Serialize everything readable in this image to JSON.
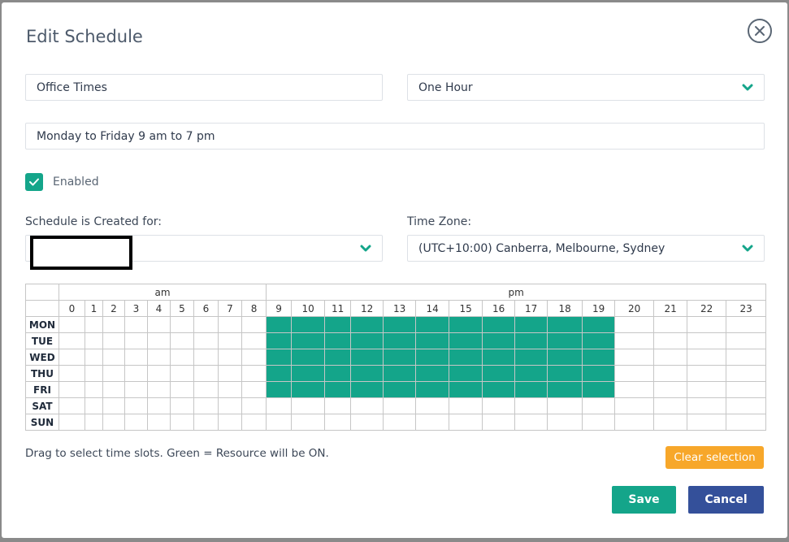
{
  "modal": {
    "title": "Edit Schedule",
    "close_icon": "close-circle-icon"
  },
  "form": {
    "name": {
      "value": "Office Times"
    },
    "interval": {
      "value": "One Hour",
      "icon": "chevron-down-icon"
    },
    "description": {
      "value": "Monday to Friday 9 am to 7 pm"
    },
    "enabled": {
      "label": "Enabled",
      "checked": true
    },
    "created_for": {
      "label": "Schedule is Created for:",
      "value": "",
      "icon": "chevron-down-icon"
    },
    "timezone": {
      "label": "Time Zone:",
      "value": "(UTC+10:00) Canberra, Melbourne, Sydney",
      "icon": "chevron-down-icon"
    }
  },
  "grid": {
    "am_label": "am",
    "pm_label": "pm",
    "hours": [
      "0",
      "1",
      "2",
      "3",
      "4",
      "5",
      "6",
      "7",
      "8",
      "9",
      "10",
      "11",
      "12",
      "13",
      "14",
      "15",
      "16",
      "17",
      "18",
      "19",
      "20",
      "21",
      "22",
      "23"
    ],
    "days": [
      "MON",
      "TUE",
      "WED",
      "THU",
      "FRI",
      "SAT",
      "SUN"
    ],
    "selected_color": "#14a58a",
    "selected": {
      "MON": [
        9,
        10,
        11,
        12,
        13,
        14,
        15,
        16,
        17,
        18,
        19
      ],
      "TUE": [
        9,
        10,
        11,
        12,
        13,
        14,
        15,
        16,
        17,
        18,
        19
      ],
      "WED": [
        9,
        10,
        11,
        12,
        13,
        14,
        15,
        16,
        17,
        18,
        19
      ],
      "THU": [
        9,
        10,
        11,
        12,
        13,
        14,
        15,
        16,
        17,
        18,
        19
      ],
      "FRI": [
        9,
        10,
        11,
        12,
        13,
        14,
        15,
        16,
        17,
        18,
        19
      ],
      "SAT": [],
      "SUN": []
    }
  },
  "hint": "Drag to select time slots. Green = Resource will be ON.",
  "buttons": {
    "clear": "Clear selection",
    "save": "Save",
    "cancel": "Cancel"
  },
  "colors": {
    "accent": "#14a58a",
    "warning": "#f7a72a",
    "primary": "#34509a"
  }
}
